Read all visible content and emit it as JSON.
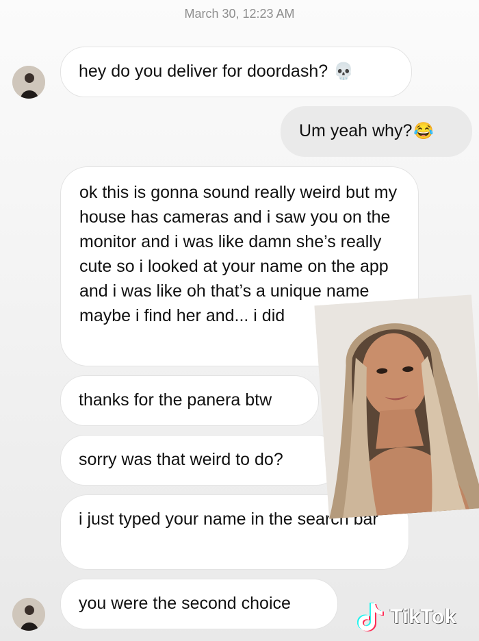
{
  "header": {
    "timestamp": "March 30, 12:23 AM"
  },
  "messages": [
    {
      "text": "hey do you deliver for doordash?",
      "emoji": "💀"
    },
    {
      "text": "Um yeah why?",
      "emoji": "😂"
    },
    {
      "text": "ok this is gonna sound really weird but my house has cameras and i saw you on the monitor and i was like damn she’s really cute so i looked at your name on the app and i was like oh that’s a unique name maybe i find her and... i did"
    },
    {
      "text": "thanks for the panera btw"
    },
    {
      "text": "sorry was that weird to do?"
    },
    {
      "text": "i just typed your name in the search bar"
    },
    {
      "text": "you were the second choice"
    }
  ],
  "watermark": {
    "label": "TikTok"
  }
}
